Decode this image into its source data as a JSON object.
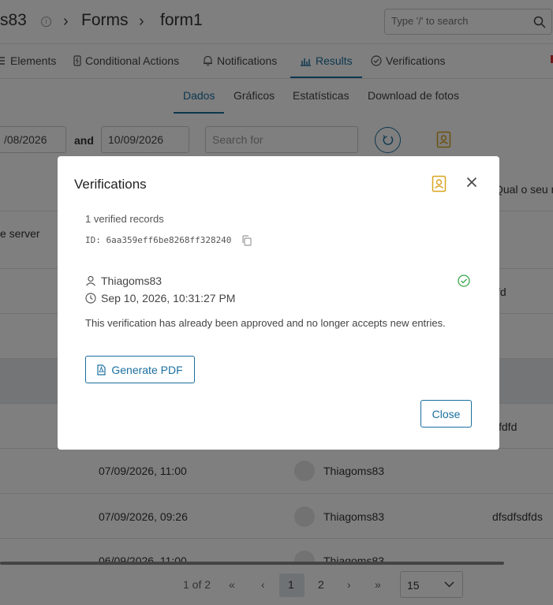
{
  "header": {
    "breadcrumb_root": "s83",
    "breadcrumb_forms": "Forms",
    "breadcrumb_form": "form1",
    "search_placeholder": "Type '/' to search"
  },
  "nav": {
    "tabs": [
      {
        "label": "Elements"
      },
      {
        "label": "Conditional Actions"
      },
      {
        "label": "Notifications"
      },
      {
        "label": "Results"
      },
      {
        "label": "Verifications"
      }
    ]
  },
  "subtabs": [
    {
      "label": "Dados"
    },
    {
      "label": "Gráficos"
    },
    {
      "label": "Estatísticas"
    },
    {
      "label": "Download de fotos"
    }
  ],
  "filters": {
    "date_from": "/08/2026",
    "and_label": "and",
    "date_to": "10/09/2026",
    "search_placeholder": "Search for"
  },
  "table": {
    "header_col_right": "Qual o seu n",
    "server_text": "e server",
    "rows": [
      {
        "date": "",
        "user": "",
        "value": "fd"
      },
      {
        "date": "",
        "user": "",
        "value": ""
      },
      {
        "date": "",
        "user": "",
        "value": "fdfd"
      },
      {
        "date": "07/09/2026, 11:00",
        "user": "Thiagoms83",
        "value": ""
      },
      {
        "date": "07/09/2026, 09:26",
        "user": "Thiagoms83",
        "value": "dfsdfsdfds"
      },
      {
        "date": "06/09/2026, 11:00",
        "user": "Thiagoms83",
        "value": ""
      }
    ]
  },
  "pager": {
    "summary": "1 of 2",
    "pages": [
      "1",
      "2"
    ],
    "per_page": "15"
  },
  "modal": {
    "title": "Verifications",
    "count": "1 verified records",
    "id": "ID: 6aa359eff6be8268ff328240",
    "user": "Thiagoms83",
    "date": "Sep 10, 2026, 10:31:27 PM",
    "message": "This verification has already been approved and no longer accepts new entries.",
    "pdf_label": "Generate PDF",
    "close_label": "Close"
  }
}
